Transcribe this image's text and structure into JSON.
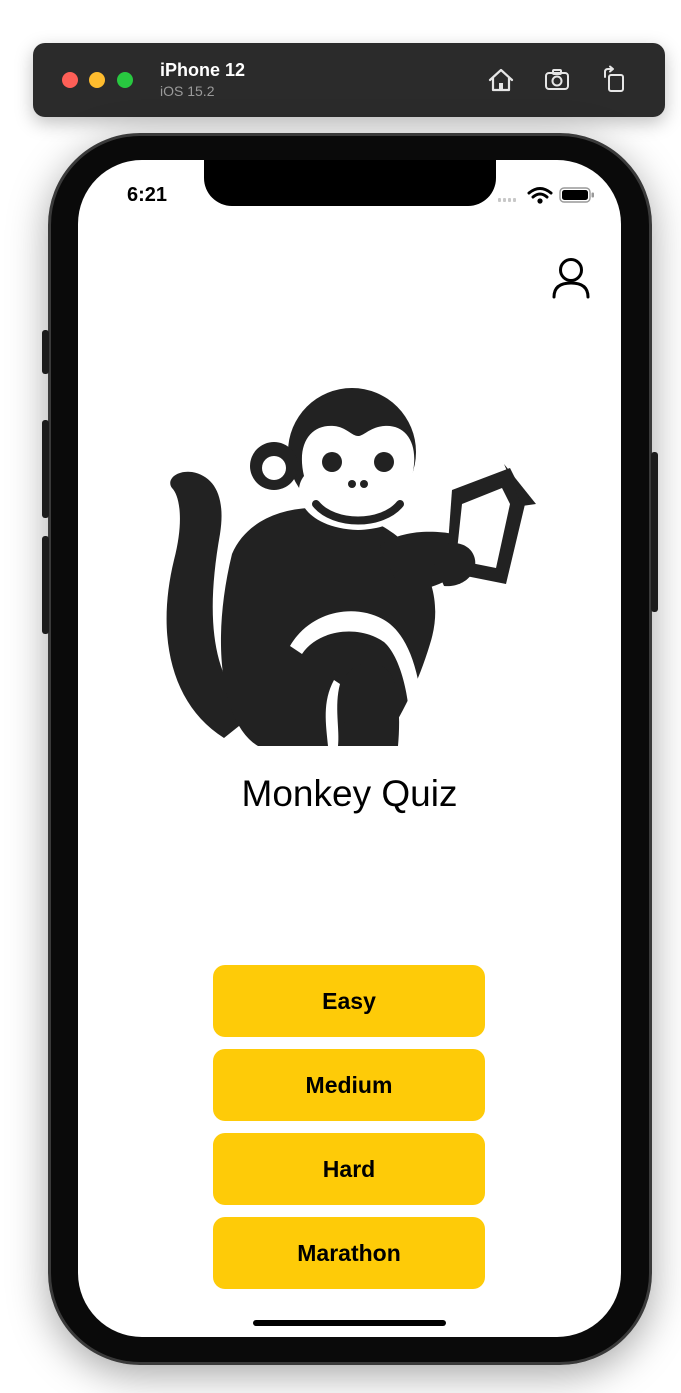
{
  "simulator": {
    "device_name": "iPhone 12",
    "os_version": "iOS 15.2",
    "tools": [
      "home-icon",
      "screenshot-icon",
      "rotate-icon"
    ]
  },
  "status_bar": {
    "time": "6:21",
    "icons": [
      "signal-icon",
      "wifi-icon",
      "battery-icon"
    ]
  },
  "app": {
    "title": "Monkey Quiz",
    "profile_icon": "person-icon",
    "logo_icon": "monkey-reading-icon",
    "buttons": [
      {
        "label": "Easy"
      },
      {
        "label": "Medium"
      },
      {
        "label": "Hard"
      },
      {
        "label": "Marathon"
      }
    ],
    "button_color": "#fecb08"
  }
}
